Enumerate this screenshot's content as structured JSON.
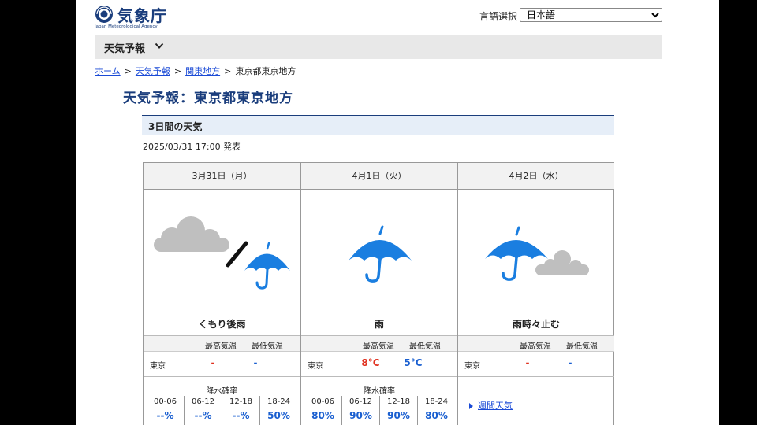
{
  "header": {
    "logo_name": "気象庁",
    "logo_en": "Japan Meteorological Agency",
    "lang_label": "言語選択",
    "lang_selected": "日本語"
  },
  "menu": {
    "label": "天気予報"
  },
  "breadcrumb": {
    "home": "ホーム",
    "forecast": "天気予報",
    "region": "関東地方",
    "current": "東京都東京地方",
    "sep": ">"
  },
  "page_title": "天気予報：東京都東京地方",
  "section": {
    "title": "3日間の天気",
    "issued": "2025/03/31 17:00 発表"
  },
  "labels": {
    "max_temp": "最高気温",
    "min_temp": "最低気温",
    "pop_title": "降水確率"
  },
  "days": [
    {
      "date": "3月31日（月）",
      "icon": "cloudy-then-rain-icon",
      "weather": "くもり後雨",
      "city": "東京",
      "max": "-",
      "min": "-",
      "pop": [
        {
          "range": "00-06",
          "value": "--%"
        },
        {
          "range": "06-12",
          "value": "--%"
        },
        {
          "range": "12-18",
          "value": "--%"
        },
        {
          "range": "18-24",
          "value": "50%"
        }
      ]
    },
    {
      "date": "4月1日（火）",
      "icon": "rain-icon",
      "weather": "雨",
      "city": "東京",
      "max": "8°C",
      "min": "5°C",
      "pop": [
        {
          "range": "00-06",
          "value": "80%"
        },
        {
          "range": "06-12",
          "value": "90%"
        },
        {
          "range": "12-18",
          "value": "90%"
        },
        {
          "range": "18-24",
          "value": "80%"
        }
      ]
    },
    {
      "date": "4月2日（水）",
      "icon": "rain-occasionally-stopping-icon",
      "weather": "雨時々止む",
      "city": "東京",
      "max": "-",
      "min": "-",
      "weekly_link": "週間天気"
    }
  ],
  "colors": {
    "brand": "#1a3d7c",
    "max_temp": "#e0301e",
    "min_temp": "#1a5fd0",
    "link": "#1a4ad6",
    "umbrella": "#1a7ee0",
    "cloud": "#bfbfbf"
  }
}
